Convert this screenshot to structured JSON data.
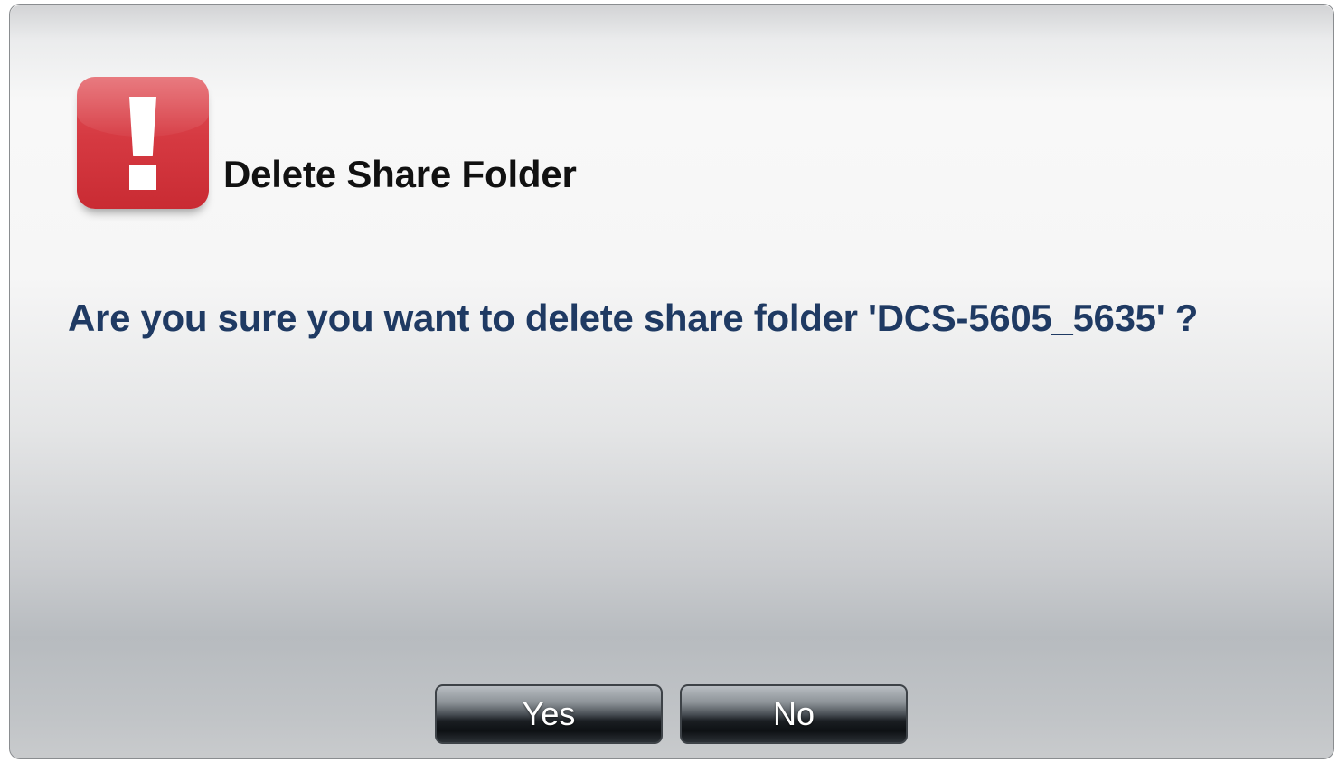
{
  "dialog": {
    "icon": "exclamation-alert-icon",
    "title": "Delete Share Folder",
    "message": "Are you sure you want to delete share folder 'DCS-5605_5635' ?",
    "buttons": {
      "yes_label": "Yes",
      "no_label": "No"
    }
  },
  "colors": {
    "icon_red": "#d63a42",
    "message_text": "#1f3a63",
    "title_text": "#111111",
    "button_dark": "#1a1e22"
  }
}
